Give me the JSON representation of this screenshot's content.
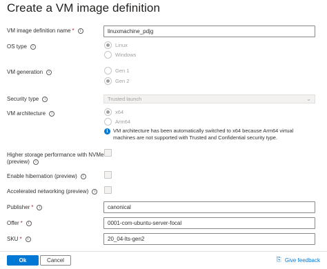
{
  "title": "Create a VM image definition",
  "fields": {
    "name": {
      "label": "VM image definition name",
      "value": "linuxmachine_pdjg"
    },
    "os_type": {
      "label": "OS type",
      "options": [
        "Linux",
        "Windows"
      ],
      "selected": "Linux"
    },
    "vm_generation": {
      "label": "VM generation",
      "options": [
        "Gen 1",
        "Gen 2"
      ],
      "selected": "Gen 2"
    },
    "security_type": {
      "label": "Security type",
      "value": "Trusted launch"
    },
    "vm_architecture": {
      "label": "VM architecture",
      "options": [
        "x64",
        "Arm64"
      ],
      "selected": "x64",
      "note": "VM architecture has been automatically switched to x64 because Arm64 virtual machines are not supported with Trusted and Confidential security type."
    },
    "nvme": {
      "label_line1": "Higher storage performance with NVMe",
      "label_line2": "(preview)",
      "checked": false
    },
    "hibernation": {
      "label": "Enable hibernation (preview)",
      "checked": false
    },
    "accel_net": {
      "label": "Accelerated networking (preview)",
      "checked": false
    },
    "publisher": {
      "label": "Publisher",
      "value": "canonical"
    },
    "offer": {
      "label": "Offer",
      "value": "0001-com-ubuntu-server-focal"
    },
    "sku": {
      "label": "SKU",
      "value": "20_04-lts-gen2"
    }
  },
  "footer": {
    "ok_label": "Ok",
    "cancel_label": "Cancel",
    "feedback_label": "Give feedback"
  },
  "icons": {
    "info": "info-icon",
    "chevron": "chevron-down-icon",
    "feedback": "feedback-icon"
  },
  "colors": {
    "accent": "#0078d4",
    "required": "#a4262c",
    "disabled_text": "#a19f9d"
  },
  "glyphs": {
    "required_mark": "*",
    "info": "i",
    "chevron": "⌄",
    "feedback": "⎘"
  }
}
